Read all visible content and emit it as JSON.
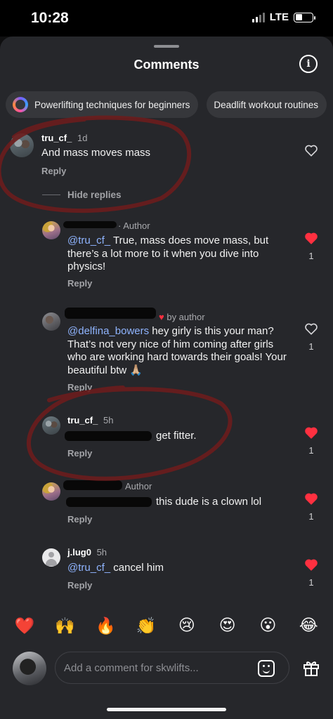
{
  "status": {
    "time": "10:28",
    "network": "LTE",
    "battery_level": 0.4
  },
  "header": {
    "title": "Comments",
    "info_icon": "info-icon"
  },
  "chips": [
    {
      "label": "Powerlifting techniques for beginners",
      "icon": "search-ring-icon"
    },
    {
      "label": "Deadlift workout routines"
    }
  ],
  "comments": {
    "c1": {
      "username": "tru_cf_",
      "time": "1d",
      "text": "And mass moves mass",
      "reply": "Reply",
      "liked": false
    },
    "hide_replies": "Hide replies",
    "r1": {
      "author_badge": "· Author",
      "mention": "@tru_cf_",
      "text": " True, mass does move mass, but there’s a lot more to it when you dive into physics!",
      "reply": "Reply",
      "likes": "1",
      "liked": true
    },
    "r2": {
      "badge": "by author",
      "mention": "@delfina_bowers",
      "text": " hey girly is this your man? That’s not very nice of him coming after girls who are working hard towards their goals! Your beautiful btw 🙏🏼",
      "reply": "Reply",
      "likes": "1",
      "liked": false
    },
    "r3": {
      "username": "tru_cf_",
      "time": "5h",
      "text": "get fitter.",
      "reply": "Reply",
      "likes": "1",
      "liked": true
    },
    "r4": {
      "author_badge": "Author",
      "text": "this dude is a clown lol",
      "reply": "Reply",
      "likes": "1",
      "liked": true
    },
    "r5": {
      "username": "j.lug0",
      "time": "5h",
      "mention": "@tru_cf_",
      "text": " cancel him",
      "reply": "Reply",
      "likes": "1",
      "liked": true
    }
  },
  "reactions": [
    "❤️",
    "🙌",
    "🔥",
    "👏",
    "😢",
    "😍",
    "😮",
    "😂"
  ],
  "composer": {
    "placeholder": "Add a comment for skwlifts...",
    "sticker_icon": "sticker-icon",
    "gift_icon": "gift-icon"
  },
  "colors": {
    "sheet": "#26272b",
    "heart": "#ff3040",
    "mention": "#8fb4ff",
    "annotation": "#6b1d1d"
  }
}
